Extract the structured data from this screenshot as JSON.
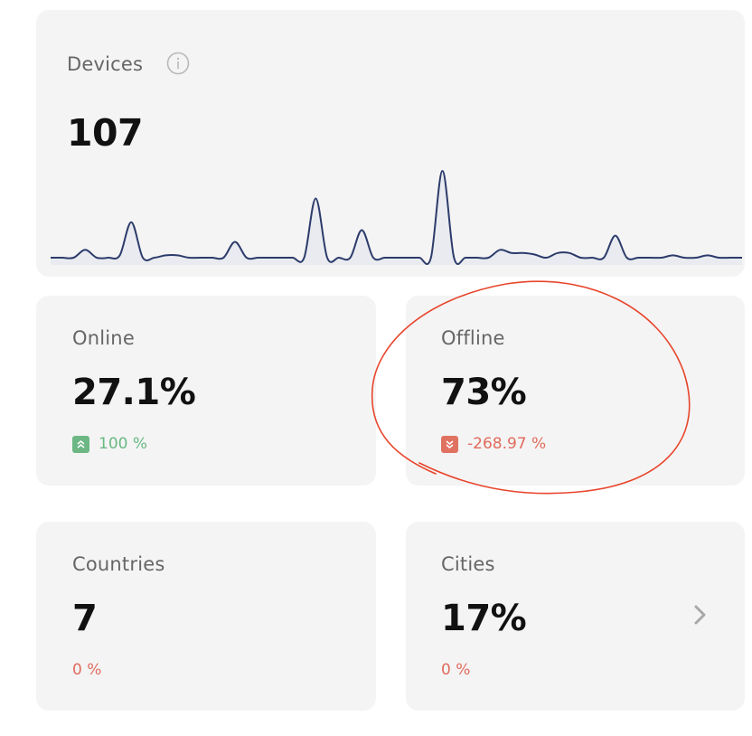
{
  "devices": {
    "title": "Devices",
    "value": "107",
    "info_icon": "info-icon",
    "sparkline_series": [
      0,
      0,
      0,
      1,
      0,
      0,
      0.3,
      4.5,
      0,
      0,
      0.3,
      0.3,
      0,
      0,
      0,
      0,
      2,
      0,
      0,
      0,
      0,
      0,
      0,
      7.5,
      0,
      0,
      0,
      3.5,
      0,
      0,
      0,
      0,
      0,
      0,
      11,
      0,
      0,
      0,
      0,
      1,
      0.6,
      0.6,
      0.4,
      0,
      0.6,
      0.6,
      0,
      0,
      0,
      2.8,
      0,
      0,
      0,
      0,
      0.3,
      0,
      0,
      0.3,
      0,
      0,
      0
    ]
  },
  "online": {
    "title": "Online",
    "value": "27.1%",
    "delta": "100 %",
    "trend_icon": "double-chevron-up-icon"
  },
  "offline": {
    "title": "Offline",
    "value": "73%",
    "delta": "-268.97 %",
    "trend_icon": "double-chevron-down-icon"
  },
  "countries": {
    "title": "Countries",
    "value": "7",
    "delta": "0 %"
  },
  "cities": {
    "title": "Cities",
    "value": "17%",
    "delta": "0 %",
    "nav_icon": "chevron-right-icon"
  },
  "colors": {
    "card_bg": "#f4f4f4",
    "sparkline": "#2c3b6b",
    "positive": "#69b883",
    "negative": "#e06b5c",
    "annotation": "#e8452c"
  }
}
